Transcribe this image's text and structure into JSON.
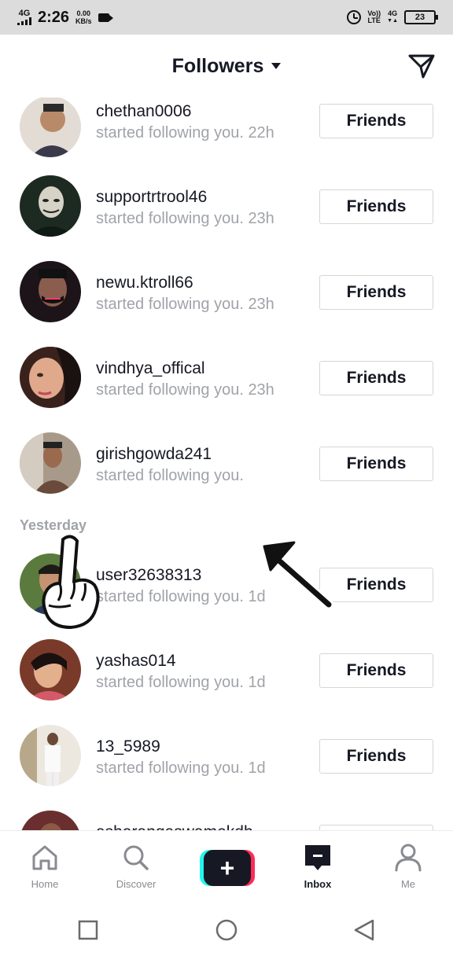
{
  "status_bar": {
    "network": "4G",
    "time": "2:26",
    "speed_value": "0.00",
    "speed_unit": "KB/s",
    "volte": "Vo))",
    "lte": "LTE",
    "network_right": "4G",
    "battery": "23"
  },
  "header": {
    "title": "Followers"
  },
  "followers": [
    {
      "username": "chethan0006",
      "subtext": "started following you. 22h",
      "button": "Friends",
      "avatar_color": "#d9b89a"
    },
    {
      "username": "supportrtrool46",
      "subtext": "started following you. 23h",
      "button": "Friends",
      "avatar_color": "#2c3a2e"
    },
    {
      "username": "newu.ktroll66",
      "subtext": "started following you. 23h",
      "button": "Friends",
      "avatar_color": "#2a1f26"
    },
    {
      "username": "vindhya_offical",
      "subtext": "started following you. 23h",
      "button": "Friends",
      "avatar_color": "#c88a6f"
    },
    {
      "username": "girishgowda241",
      "subtext": "started following you.",
      "button": "Friends",
      "avatar_color": "#7b6a58"
    }
  ],
  "section_label": "Yesterday",
  "followers_yesterday": [
    {
      "username": "user32638313",
      "subtext": "started following you. 1d",
      "button": "Friends",
      "avatar_color": "#4a6a3a"
    },
    {
      "username": "yashas014",
      "subtext": "started following you. 1d",
      "button": "Friends",
      "avatar_color": "#b35a5a"
    },
    {
      "username": "13_5989",
      "subtext": "started following you. 1d",
      "button": "Friends",
      "avatar_color": "#c9c4b8"
    },
    {
      "username": "asharangaswamekdh",
      "subtext": "",
      "button": "",
      "avatar_color": "#6b2e2e"
    }
  ],
  "bottom_nav": {
    "home": "Home",
    "discover": "Discover",
    "inbox": "Inbox",
    "me": "Me"
  },
  "icons": {
    "direct_message": "paper-plane-icon",
    "home": "home-icon",
    "discover": "search-icon",
    "create": "plus-icon",
    "inbox": "inbox-icon",
    "me": "person-icon",
    "back": "triangle-back-icon",
    "home_sys": "circle-home-icon",
    "recents": "square-recents-icon"
  },
  "colors": {
    "accent_cyan": "#25f4ee",
    "accent_red": "#fe2c55",
    "text_primary": "#161823",
    "text_secondary": "#a0a3a8"
  }
}
